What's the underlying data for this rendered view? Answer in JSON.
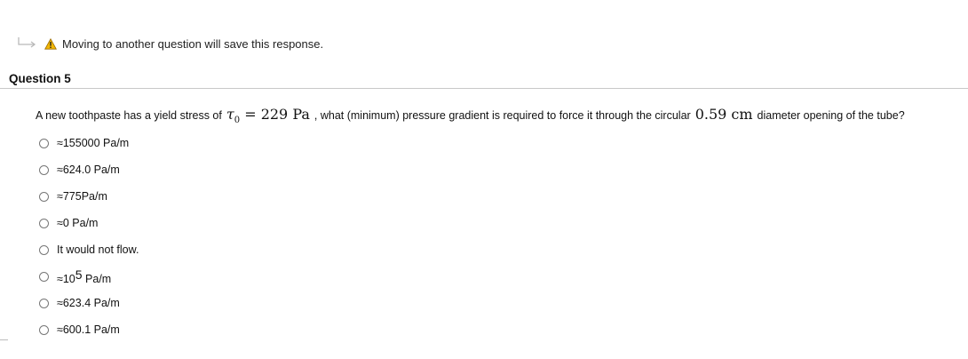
{
  "notice": {
    "message": "Moving to another question will save this response.",
    "icons": [
      "return-arrow-icon",
      "warning-icon"
    ],
    "warning_color": "#f2b705"
  },
  "question": {
    "title": "Question 5",
    "text_before_tau": "A new toothpaste has a yield stress of",
    "tau_symbol": "τ",
    "tau_sub": "0",
    "equals": "=",
    "stress_value": "229 Pa",
    "text_middle": ", what (minimum) pressure gradient is required to force it through the circular",
    "diameter_value": "0.59 cm",
    "text_after": "diameter opening of the tube?"
  },
  "options": [
    {
      "label": "≈155000 Pa/m"
    },
    {
      "label": "≈624.0 Pa/m"
    },
    {
      "label": "≈775Pa/m"
    },
    {
      "label": "≈0 Pa/m"
    },
    {
      "label": "It would not flow."
    },
    {
      "prefix": "≈10",
      "sup": "5",
      "suffix": " Pa/m"
    },
    {
      "label": "≈623.4 Pa/m"
    },
    {
      "label": "≈600.1 Pa/m"
    }
  ]
}
